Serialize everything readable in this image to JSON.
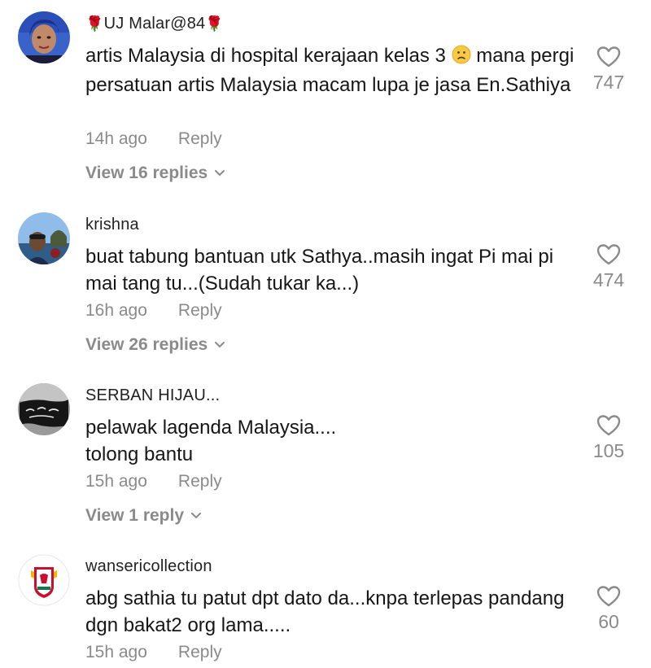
{
  "comments": [
    {
      "username": "UJ Malar@84",
      "username_prefix_emoji": "🌹",
      "username_suffix_emoji": "🌹",
      "text_before_emoji": "artis Malaysia di hospital kerajaan kelas 3",
      "text_emoji": "slightly-frowning-face",
      "text_after_emoji": " mana pergi persatuan artis Malaysia macam lupa je jasa En.Sathiya",
      "time": "14h ago",
      "reply_label": "Reply",
      "view_replies": "View 16 replies",
      "likes": "747"
    },
    {
      "username": "krishna",
      "text": "buat tabung bantuan utk Sathya..masih ingat Pi mai pi mai tang tu...(Sudah tukar ka...)",
      "time": "16h ago",
      "reply_label": "Reply",
      "view_replies": "View 26 replies",
      "likes": "474"
    },
    {
      "username": "SERBAN HIJAU...",
      "text_line1": "pelawak lagenda Malaysia....",
      "text_line2": "tolong bantu",
      "time": "15h ago",
      "reply_label": "Reply",
      "view_replies": "View 1 reply",
      "likes": "105"
    },
    {
      "username": "wansericollection",
      "text": "abg sathia tu patut dpt dato da...knpa terlepas pandang dgn bakat2 org lama.....",
      "time": "15h ago",
      "reply_label": "Reply",
      "likes": "60"
    }
  ],
  "icons": {
    "like": "heart-outline-icon",
    "expand": "chevron-down-icon"
  },
  "colors": {
    "text": "#161616",
    "secondary": "#8a8a8a",
    "rose": "#c8102e"
  }
}
